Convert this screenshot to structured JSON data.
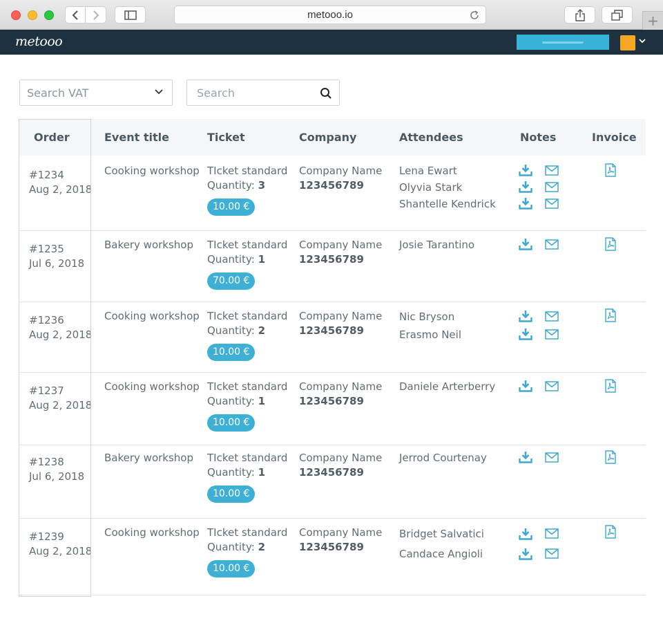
{
  "browser": {
    "url": "metooo.io"
  },
  "app": {
    "logo": "metooo"
  },
  "filters": {
    "vat_placeholder": "Search VAT",
    "search_placeholder": "Search"
  },
  "table": {
    "headers": [
      "Order",
      "Event title",
      "Ticket",
      "Company",
      "Attendees",
      "Notes",
      "Invoice"
    ],
    "rows": [
      {
        "order": "#1234",
        "date": "Aug 2, 2018",
        "event": "Cooking workshop",
        "ticket": "TIcket standard",
        "qty_label": "Quantity:",
        "qty": "3",
        "price": "10.00 €",
        "company": "Company Name",
        "company_id": "123456789",
        "attendees": [
          "Lena Ewart",
          "Olyvia Stark",
          "Shantelle Kendrick"
        ]
      },
      {
        "order": "#1235",
        "date": "Jul 6, 2018",
        "event": "Bakery workshop",
        "ticket": "TIcket standard",
        "qty_label": "Quantity:",
        "qty": "1",
        "price": "70.00 €",
        "company": "Company Name",
        "company_id": "123456789",
        "attendees": [
          "Josie Tarantino"
        ]
      },
      {
        "order": "#1236",
        "date": "Aug 2, 2018",
        "event": "Cooking workshop",
        "ticket": "TIcket standard",
        "qty_label": "Quantity:",
        "qty": "2",
        "price": "10.00 €",
        "company": "Company Name",
        "company_id": "123456789",
        "attendees": [
          "Nic Bryson",
          "Erasmo Neil"
        ]
      },
      {
        "order": "#1237",
        "date": "Aug 2, 2018",
        "event": "Cooking workshop",
        "ticket": "TIcket standard",
        "qty_label": "Quantity:",
        "qty": "1",
        "price": "10.00 €",
        "company": "Company Name",
        "company_id": "123456789",
        "attendees": [
          "Daniele Arterberry"
        ]
      },
      {
        "order": "#1238",
        "date": "Jul 6, 2018",
        "event": "Bakery workshop",
        "ticket": "TIcket standard",
        "qty_label": "Quantity:",
        "qty": "1",
        "price": "10.00 €",
        "company": "Company Name",
        "company_id": "123456789",
        "attendees": [
          "Jerrod Courtenay"
        ]
      },
      {
        "order": "#1239",
        "date": "Aug 2, 2018",
        "event": "Cooking workshop",
        "ticket": "TIcket standard",
        "qty_label": "Quantity:",
        "qty": "2",
        "price": "10.00 €",
        "company": "Company Name",
        "company_id": "123456789",
        "attendees": [
          "Bridget Salvatici",
          "Candace Angioli"
        ]
      }
    ]
  },
  "colors": {
    "accent": "#3fb0d5",
    "header_bg": "#1d3140",
    "avatar": "#f5a623"
  },
  "icons": {
    "note_download": "download-icon",
    "note_mail": "envelope-icon",
    "invoice": "pdf-file-icon"
  }
}
